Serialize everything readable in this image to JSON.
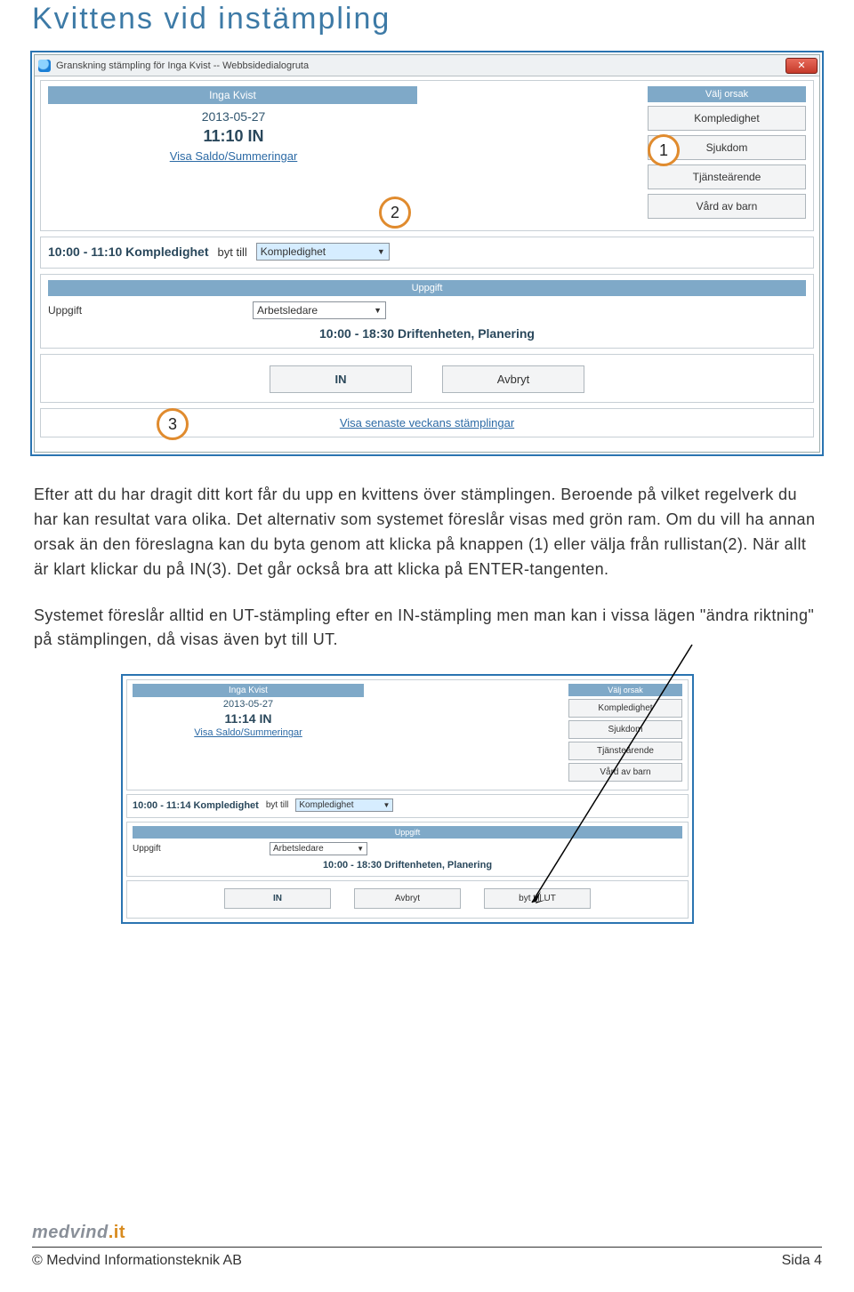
{
  "doc": {
    "title": "Kvittens vid instämpling"
  },
  "shot1": {
    "window_title": "Granskning stämpling för Inga Kvist -- Webbsidedialogruta",
    "close_glyph": "✕",
    "name": "Inga Kvist",
    "date": "2013-05-27",
    "stamp": "11:10 IN",
    "saldo_link": "Visa Saldo/Summeringar",
    "valj_orsak": "Välj orsak",
    "reasons": [
      "Kompledighet",
      "Sjukdom",
      "Tjänsteärende",
      "Vård av barn"
    ],
    "range_line": "10:00 - 11:10 Kompledighet",
    "byt_till": "byt till",
    "sel_reason": "Kompledighet",
    "uppgift_header": "Uppgift",
    "uppgift_label": "Uppgift",
    "uppgift_value": "Arbetsledare",
    "planering": "10:00 - 18:30 Driftenheten, Planering",
    "btn_in": "IN",
    "btn_cancel": "Avbryt",
    "footer_link": "Visa senaste veckans stämplingar",
    "markers": {
      "m1": "1",
      "m2": "2",
      "m3": "3"
    }
  },
  "body": {
    "p1": "Efter att du har dragit ditt kort får du upp en kvittens över stämplingen. Beroende på vilket regelverk du har kan resultat vara olika. Det alternativ som systemet föreslår visas med grön ram. Om du vill ha annan orsak än den föreslagna kan du byta genom att klicka på knappen (1) eller välja från rullistan(2). När allt är klart klickar du på IN(3). Det går också bra att klicka på ENTER-tangenten.",
    "p2": "Systemet föreslår alltid en UT-stämpling efter en IN-stämpling men man kan i vissa lägen \"ändra riktning\" på stämplingen, då visas även byt till UT."
  },
  "shot2": {
    "name": "Inga Kvist",
    "date": "2013-05-27",
    "stamp": "11:14 IN",
    "saldo_link": "Visa Saldo/Summeringar",
    "valj_orsak": "Välj orsak",
    "reasons": [
      "Kompledighet",
      "Sjukdom",
      "Tjänsteärende",
      "Vård av barn"
    ],
    "range_line": "10:00 - 11:14 Kompledighet",
    "byt_till": "byt till",
    "sel_reason": "Kompledighet",
    "uppgift_header": "Uppgift",
    "uppgift_label": "Uppgift",
    "uppgift_value": "Arbetsledare",
    "planering": "10:00 - 18:30 Driftenheten, Planering",
    "btn_in": "IN",
    "btn_cancel": "Avbryt",
    "btn_bytut": "byt till UT"
  },
  "footer": {
    "brand_a": "medvind",
    "brand_b": ".it",
    "copyright": "©  Medvind Informationsteknik AB",
    "page": "Sida 4"
  }
}
